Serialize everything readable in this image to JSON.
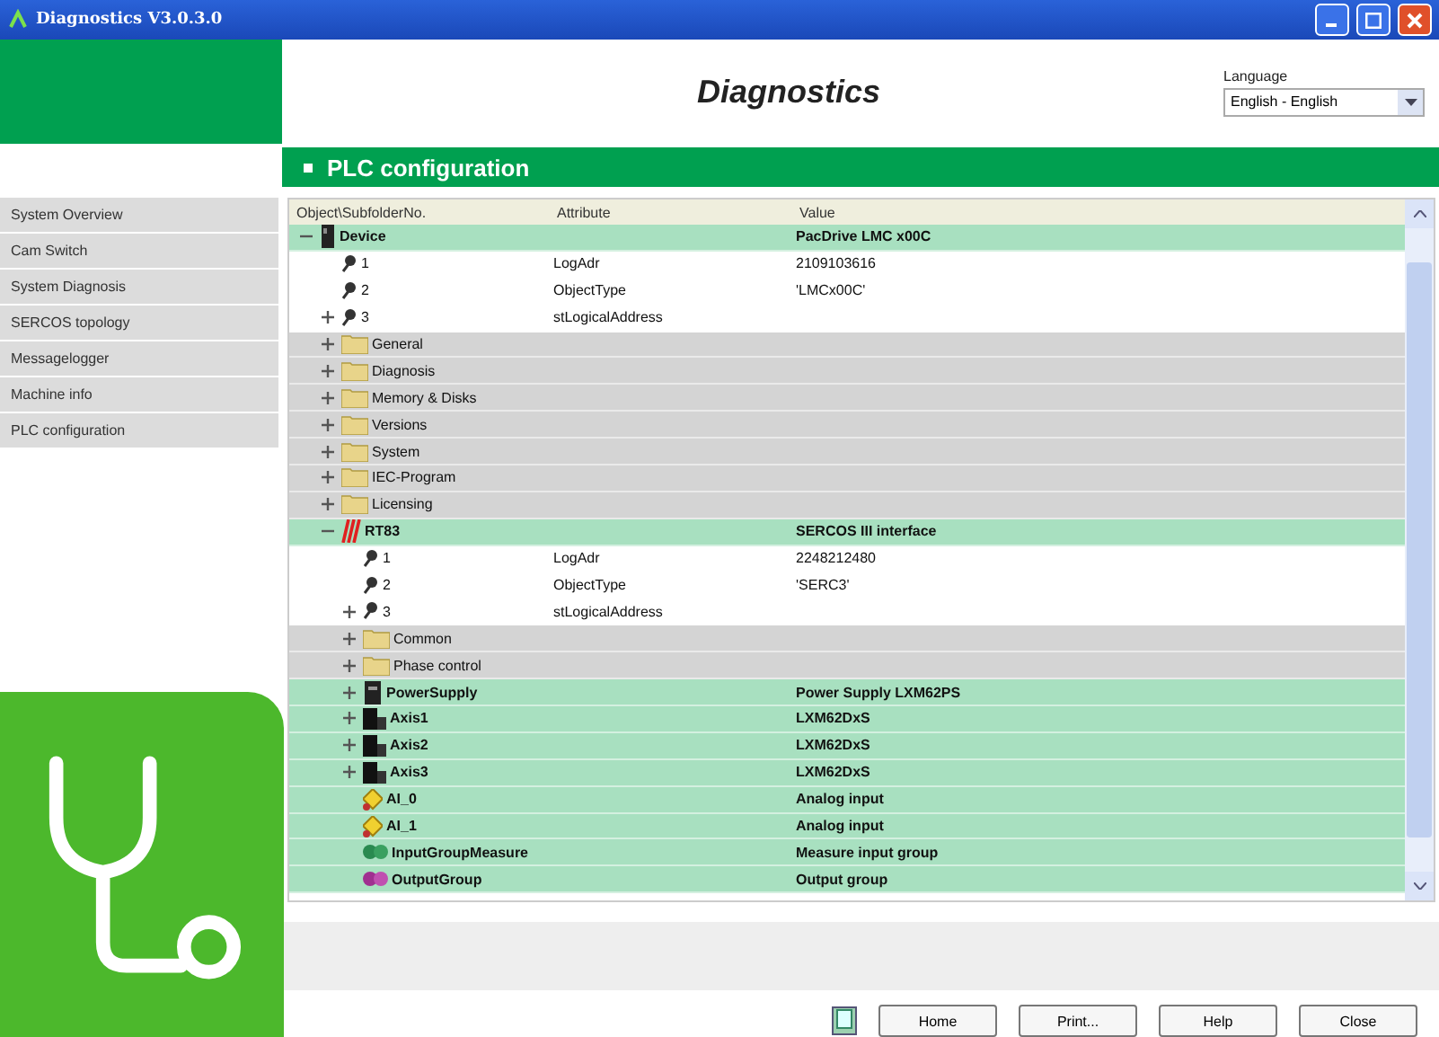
{
  "window": {
    "title": "Diagnostics V3.0.3.0"
  },
  "header": {
    "title": "Diagnostics",
    "language_label": "Language",
    "language_value": "English - English"
  },
  "section_title": "PLC configuration",
  "sidebar": {
    "items": [
      {
        "label": "System Overview",
        "selected": false
      },
      {
        "label": "Cam Switch",
        "selected": false
      },
      {
        "label": "System Diagnosis",
        "selected": false
      },
      {
        "label": "SERCOS topology",
        "selected": false
      },
      {
        "label": "Messagelogger",
        "selected": false
      },
      {
        "label": "Machine info",
        "selected": false
      },
      {
        "label": "PLC configuration",
        "selected": false
      }
    ]
  },
  "table": {
    "columns": [
      "Object\\SubfolderNo.",
      "Attribute",
      "Value"
    ],
    "rows": [
      {
        "kind": "device",
        "name": "Device",
        "value": "PacDrive LMC x00C",
        "expanded": true,
        "children": [
          {
            "kind": "param",
            "name": "1",
            "attribute": "LogAdr",
            "value": "2109103616"
          },
          {
            "kind": "param",
            "name": "2",
            "attribute": "ObjectType",
            "value": "'LMCx00C'"
          },
          {
            "kind": "param",
            "name": "3",
            "attribute": "stLogicalAddress",
            "expanded": false
          },
          {
            "kind": "folder",
            "name": "General",
            "expanded": false
          },
          {
            "kind": "folder",
            "name": "Diagnosis",
            "expanded": false
          },
          {
            "kind": "folder",
            "name": "Memory & Disks",
            "expanded": false
          },
          {
            "kind": "folder",
            "name": "Versions",
            "expanded": false
          },
          {
            "kind": "folder",
            "name": "System",
            "expanded": false
          },
          {
            "kind": "folder",
            "name": "IEC-Program",
            "expanded": false
          },
          {
            "kind": "folder",
            "name": "Licensing",
            "expanded": false
          },
          {
            "kind": "interface",
            "name": "RT83",
            "value": "SERCOS III interface",
            "expanded": true,
            "children": [
              {
                "kind": "param",
                "name": "1",
                "attribute": "LogAdr",
                "value": "2248212480"
              },
              {
                "kind": "param",
                "name": "2",
                "attribute": "ObjectType",
                "value": "'SERC3'"
              },
              {
                "kind": "param",
                "name": "3",
                "attribute": "stLogicalAddress",
                "expanded": false
              },
              {
                "kind": "folder",
                "name": "Common",
                "expanded": false
              },
              {
                "kind": "folder",
                "name": "Phase control",
                "expanded": false
              },
              {
                "kind": "supply",
                "name": "PowerSupply",
                "value": "Power Supply LXM62PS",
                "expanded": false
              },
              {
                "kind": "axis",
                "name": "Axis1",
                "value": "LXM62DxS",
                "expanded": false
              },
              {
                "kind": "axis",
                "name": "Axis2",
                "value": "LXM62DxS",
                "expanded": false
              },
              {
                "kind": "axis",
                "name": "Axis3",
                "value": "LXM62DxS",
                "expanded": false
              },
              {
                "kind": "input",
                "name": "AI_0",
                "value": "Analog input"
              },
              {
                "kind": "input",
                "name": "AI_1",
                "value": "Analog input"
              },
              {
                "kind": "inputgroup",
                "name": "InputGroupMeasure",
                "value": "Measure input group"
              },
              {
                "kind": "outputgroup",
                "name": "OutputGroup",
                "value": "Output group"
              }
            ]
          }
        ]
      }
    ]
  },
  "buttons": [
    "Home",
    "Print...",
    "Help",
    "Close"
  ]
}
